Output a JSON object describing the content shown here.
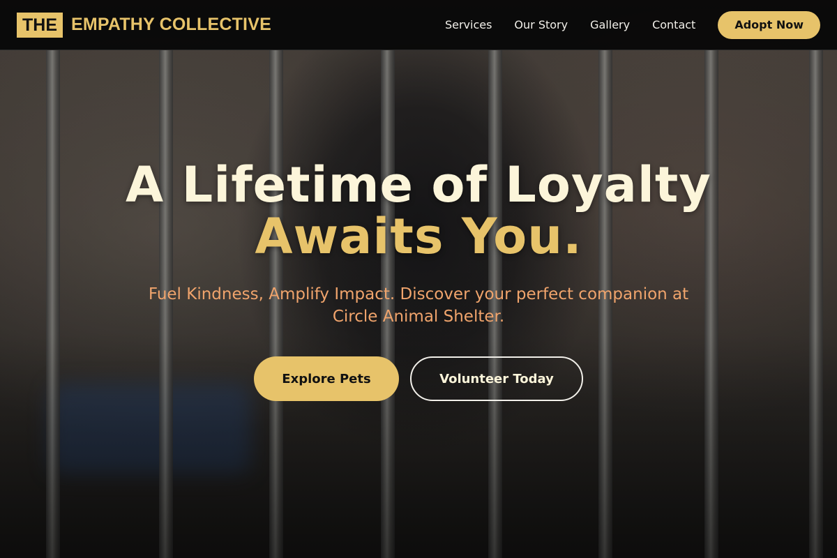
{
  "brand": {
    "mark": "THE",
    "name": "EMPATHY COLLECTIVE",
    "accent_color": "#e7c36a"
  },
  "nav": {
    "links": [
      "Services",
      "Our Story",
      "Gallery",
      "Contact"
    ],
    "cta": "Adopt Now"
  },
  "hero": {
    "headline_line1": "A Lifetime of Loyalty",
    "headline_line2": "Awaits You.",
    "subtext": "Fuel Kindness, Amplify Impact. Discover your perfect companion at Circle Animal Shelter.",
    "primary_button": "Explore Pets",
    "secondary_button": "Volunteer Today",
    "background_image": "kitten-behind-cage-bars"
  },
  "colors": {
    "headline": "#fcf5da",
    "subtext": "#f0a46c",
    "navbar": "#080808"
  }
}
